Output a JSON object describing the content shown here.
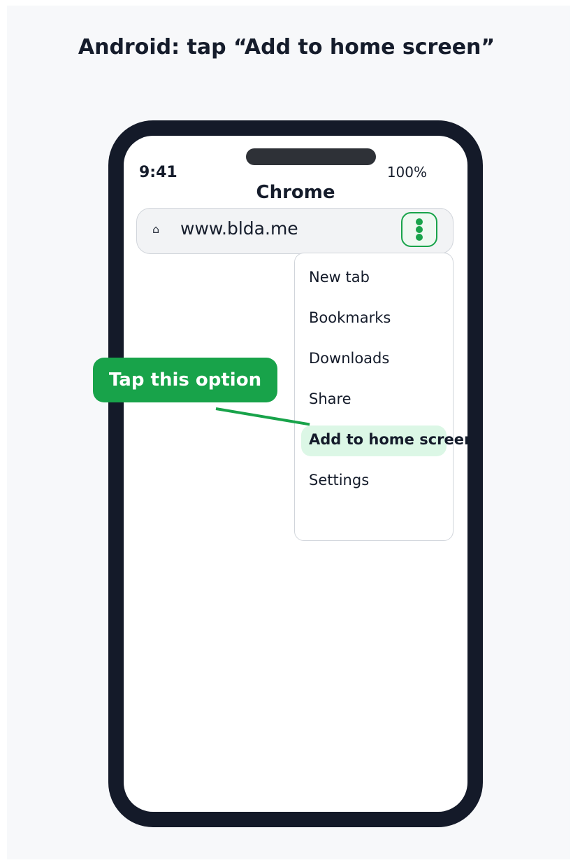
{
  "headline": "Android: tap “Add to home screen”",
  "status_bar": {
    "time": "9:41",
    "battery": "100%"
  },
  "app": {
    "title": "Chrome"
  },
  "address_bar": {
    "home_icon": "home-icon",
    "url": "www.blda.me",
    "menu_icon": "kebab-menu-icon"
  },
  "menu": {
    "items": [
      {
        "label": "New tab"
      },
      {
        "label": "Bookmarks"
      },
      {
        "label": "Downloads"
      },
      {
        "label": "Share"
      },
      {
        "label": "Add to home screen"
      },
      {
        "label": "Settings"
      }
    ],
    "highlighted_index": 4
  },
  "callout": {
    "label": "Tap this option"
  },
  "colors": {
    "accent": "#18a34a",
    "highlight": "#dcf7e6",
    "phone_frame": "#141a29",
    "text": "#151c2b"
  }
}
